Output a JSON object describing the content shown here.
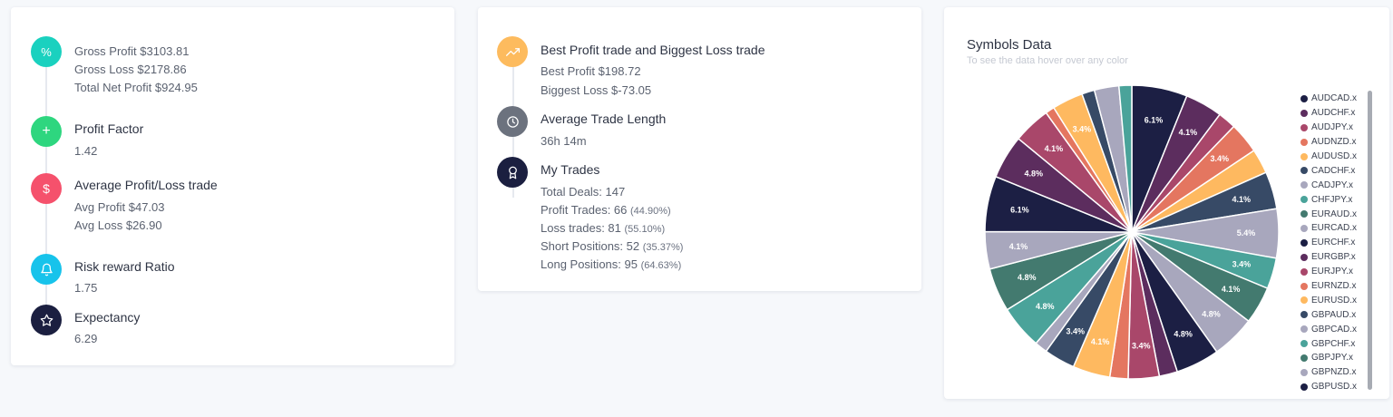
{
  "card1": {
    "gross_profit": "Gross Profit $3103.81",
    "gross_loss": "Gross Loss $2178.86",
    "net_profit": "Total Net Profit $924.95",
    "profit_factor_title": "Profit Factor",
    "profit_factor_value": "1.42",
    "avg_title": "Average Profit/Loss trade",
    "avg_profit": "Avg Profit $47.03",
    "avg_loss": "Avg Loss $26.90",
    "risk_title": "Risk reward Ratio",
    "risk_value": "1.75",
    "expectancy_title": "Expectancy",
    "expectancy_value": "6.29",
    "icons": {
      "percent": {
        "name": "percent-icon",
        "color": "#1ad1bf"
      },
      "plus": {
        "name": "plus-icon",
        "color": "#2ed67f"
      },
      "dollar": {
        "name": "dollar-icon",
        "color": "#f5516c"
      },
      "bell": {
        "name": "bell-icon",
        "color": "#17c3eb"
      },
      "star": {
        "name": "star-icon",
        "color": "#1b1f40"
      }
    }
  },
  "card2": {
    "best_title": "Best Profit trade and Biggest Loss trade",
    "best_profit": "Best Profit $198.72",
    "biggest_loss": "Biggest Loss $-73.05",
    "avg_len_title": "Average Trade Length",
    "avg_len_value": "36h 14m",
    "my_trades_title": "My Trades",
    "total_deals": "Total Deals: 147",
    "profit_trades": "Profit Trades: 66",
    "profit_trades_pct": "(44.90%)",
    "loss_trades": "Loss trades: 81",
    "loss_trades_pct": "(55.10%)",
    "short_positions": "Short Positions: 52",
    "short_positions_pct": "(35.37%)",
    "long_positions": "Long Positions: 95",
    "long_positions_pct": "(64.63%)",
    "icons": {
      "trend": {
        "name": "trending-up-icon",
        "color": "#fdbb5e"
      },
      "clock": {
        "name": "clock-icon",
        "color": "#6c727e"
      },
      "award": {
        "name": "award-icon",
        "color": "#1b1f40"
      }
    }
  },
  "symbols": {
    "title": "Symbols Data",
    "subtitle": "To see the data hover over any color",
    "legend": [
      {
        "label": "AUDCAD.x",
        "color": "#1c1f44"
      },
      {
        "label": "AUDCHF.x",
        "color": "#5c2d5e"
      },
      {
        "label": "AUDJPY.x",
        "color": "#a9476a"
      },
      {
        "label": "AUDNZD.x",
        "color": "#e47660"
      },
      {
        "label": "AUDUSD.x",
        "color": "#feb960"
      },
      {
        "label": "CADCHF.x",
        "color": "#374a66"
      },
      {
        "label": "CADJPY.x",
        "color": "#a8a7bd"
      },
      {
        "label": "CHFJPY.x",
        "color": "#4aa39a"
      },
      {
        "label": "EURAUD.x",
        "color": "#437a6f"
      },
      {
        "label": "EURCAD.x",
        "color": "#a8a7bd"
      },
      {
        "label": "EURCHF.x",
        "color": "#1c1f44"
      },
      {
        "label": "EURGBP.x",
        "color": "#5c2d5e"
      },
      {
        "label": "EURJPY.x",
        "color": "#a9476a"
      },
      {
        "label": "EURNZD.x",
        "color": "#e47660"
      },
      {
        "label": "EURUSD.x",
        "color": "#feb960"
      },
      {
        "label": "GBPAUD.x",
        "color": "#374a66"
      },
      {
        "label": "GBPCAD.x",
        "color": "#a8a7bd"
      },
      {
        "label": "GBPCHF.x",
        "color": "#4aa39a"
      },
      {
        "label": "GBPJPY.x",
        "color": "#437a6f"
      },
      {
        "label": "GBPNZD.x",
        "color": "#a8a7bd"
      },
      {
        "label": "GBPUSD.x",
        "color": "#1c1f44"
      }
    ]
  },
  "chart_data": {
    "type": "pie",
    "slices": [
      {
        "value": 6.1,
        "label": "6.1%",
        "color": "#1c1f44"
      },
      {
        "value": 4.1,
        "label": "4.1%",
        "color": "#5c2d5e"
      },
      {
        "value": 2.0,
        "label": "",
        "color": "#a9476a"
      },
      {
        "value": 3.4,
        "label": "3.4%",
        "color": "#e47660"
      },
      {
        "value": 2.7,
        "label": "",
        "color": "#feb960"
      },
      {
        "value": 4.1,
        "label": "4.1%",
        "color": "#374a66"
      },
      {
        "value": 5.4,
        "label": "5.4%",
        "color": "#a8a7bd"
      },
      {
        "value": 3.4,
        "label": "3.4%",
        "color": "#4aa39a"
      },
      {
        "value": 4.1,
        "label": "4.1%",
        "color": "#437a6f"
      },
      {
        "value": 4.8,
        "label": "4.8%",
        "color": "#a8a7bd"
      },
      {
        "value": 4.8,
        "label": "4.8%",
        "color": "#1c1f44"
      },
      {
        "value": 2.0,
        "label": "",
        "color": "#5c2d5e"
      },
      {
        "value": 3.4,
        "label": "3.4%",
        "color": "#a9476a"
      },
      {
        "value": 2.0,
        "label": "",
        "color": "#e47660"
      },
      {
        "value": 4.1,
        "label": "4.1%",
        "color": "#feb960"
      },
      {
        "value": 3.4,
        "label": "3.4%",
        "color": "#374a66"
      },
      {
        "value": 1.4,
        "label": "",
        "color": "#a8a7bd"
      },
      {
        "value": 4.8,
        "label": "4.8%",
        "color": "#4aa39a"
      },
      {
        "value": 4.8,
        "label": "4.8%",
        "color": "#437a6f"
      },
      {
        "value": 4.1,
        "label": "4.1%",
        "color": "#a8a7bd"
      },
      {
        "value": 6.1,
        "label": "6.1%",
        "color": "#1c1f44"
      },
      {
        "value": 4.8,
        "label": "4.8%",
        "color": "#5c2d5e"
      },
      {
        "value": 4.1,
        "label": "4.1%",
        "color": "#a9476a"
      },
      {
        "value": 1.0,
        "label": "",
        "color": "#e47660"
      },
      {
        "value": 3.4,
        "label": "3.4%",
        "color": "#feb960"
      },
      {
        "value": 1.4,
        "label": "",
        "color": "#374a66"
      },
      {
        "value": 2.7,
        "label": "",
        "color": "#a8a7bd"
      },
      {
        "value": 1.4,
        "label": "",
        "color": "#4aa39a"
      }
    ]
  }
}
